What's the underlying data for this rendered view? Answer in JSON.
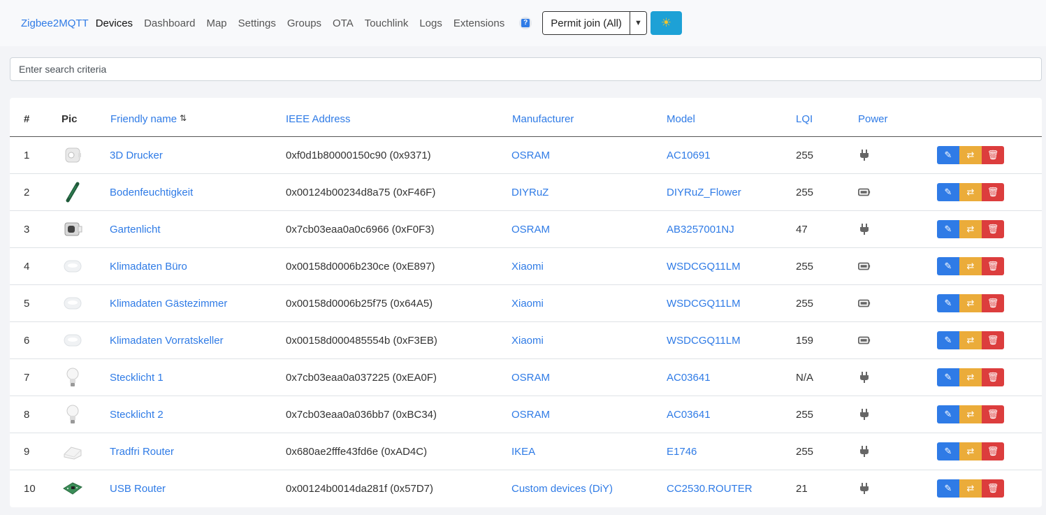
{
  "nav": {
    "brand": "Zigbee2MQTT",
    "links": [
      "Devices",
      "Dashboard",
      "Map",
      "Settings",
      "Groups",
      "OTA",
      "Touchlink",
      "Logs",
      "Extensions"
    ],
    "permit_join_label": "Permit join (All)"
  },
  "search": {
    "placeholder": "Enter search criteria"
  },
  "table": {
    "headers": {
      "num": "#",
      "pic": "Pic",
      "friendly_name": "Friendly name",
      "ieee": "IEEE Address",
      "manufacturer": "Manufacturer",
      "model": "Model",
      "lqi": "LQI",
      "power": "Power"
    },
    "sorted_by": "friendly_name",
    "rows": [
      {
        "num": "1",
        "name": "3D Drucker",
        "ieee": "0xf0d1b80000150c90 (0x9371)",
        "manufacturer": "OSRAM",
        "model": "AC10691",
        "lqi": "255",
        "power": "plug-icon",
        "pic": "smart-plug"
      },
      {
        "num": "2",
        "name": "Bodenfeuchtigkeit",
        "ieee": "0x00124b00234d8a75 (0xF46F)",
        "manufacturer": "DIYRuZ",
        "model": "DIYRuZ_Flower",
        "lqi": "255",
        "power": "battery-icon",
        "pic": "soil-sensor"
      },
      {
        "num": "3",
        "name": "Gartenlicht",
        "ieee": "0x7cb03eaa0a0c6966 (0xF0F3)",
        "manufacturer": "OSRAM",
        "model": "AB3257001NJ",
        "lqi": "47",
        "power": "plug-icon",
        "pic": "outdoor-plug"
      },
      {
        "num": "4",
        "name": "Klimadaten Büro",
        "ieee": "0x00158d0006b230ce (0xE897)",
        "manufacturer": "Xiaomi",
        "model": "WSDCGQ11LM",
        "lqi": "255",
        "power": "battery-icon",
        "pic": "climate-sensor"
      },
      {
        "num": "5",
        "name": "Klimadaten Gästezimmer",
        "ieee": "0x00158d0006b25f75 (0x64A5)",
        "manufacturer": "Xiaomi",
        "model": "WSDCGQ11LM",
        "lqi": "255",
        "power": "battery-icon",
        "pic": "climate-sensor"
      },
      {
        "num": "6",
        "name": "Klimadaten Vorratskeller",
        "ieee": "0x00158d000485554b (0xF3EB)",
        "manufacturer": "Xiaomi",
        "model": "WSDCGQ11LM",
        "lqi": "159",
        "power": "battery-icon",
        "pic": "climate-sensor"
      },
      {
        "num": "7",
        "name": "Stecklicht 1",
        "ieee": "0x7cb03eaa0a037225 (0xEA0F)",
        "manufacturer": "OSRAM",
        "model": "AC03641",
        "lqi": "N/A",
        "power": "plug-icon",
        "pic": "light-bulb"
      },
      {
        "num": "8",
        "name": "Stecklicht 2",
        "ieee": "0x7cb03eaa0a036bb7 (0xBC34)",
        "manufacturer": "OSRAM",
        "model": "AC03641",
        "lqi": "255",
        "power": "plug-icon",
        "pic": "light-bulb"
      },
      {
        "num": "9",
        "name": "Tradfri Router",
        "ieee": "0x680ae2fffe43fd6e (0xAD4C)",
        "manufacturer": "IKEA",
        "model": "E1746",
        "lqi": "255",
        "power": "plug-icon",
        "pic": "router-plug"
      },
      {
        "num": "10",
        "name": "USB Router",
        "ieee": "0x00124b0014da281f (0x57D7)",
        "manufacturer": "Custom devices (DiY)",
        "model": "CC2530.ROUTER",
        "lqi": "21",
        "power": "plug-icon",
        "pic": "usb-board"
      }
    ],
    "actions": [
      "edit-icon",
      "rename-icon",
      "trash-icon"
    ]
  },
  "colors": {
    "link": "#2f7be6",
    "edit": "#2f7be6",
    "rename": "#ebac3a",
    "remove": "#dc3d3d",
    "theme_button": "#1da1d6"
  }
}
